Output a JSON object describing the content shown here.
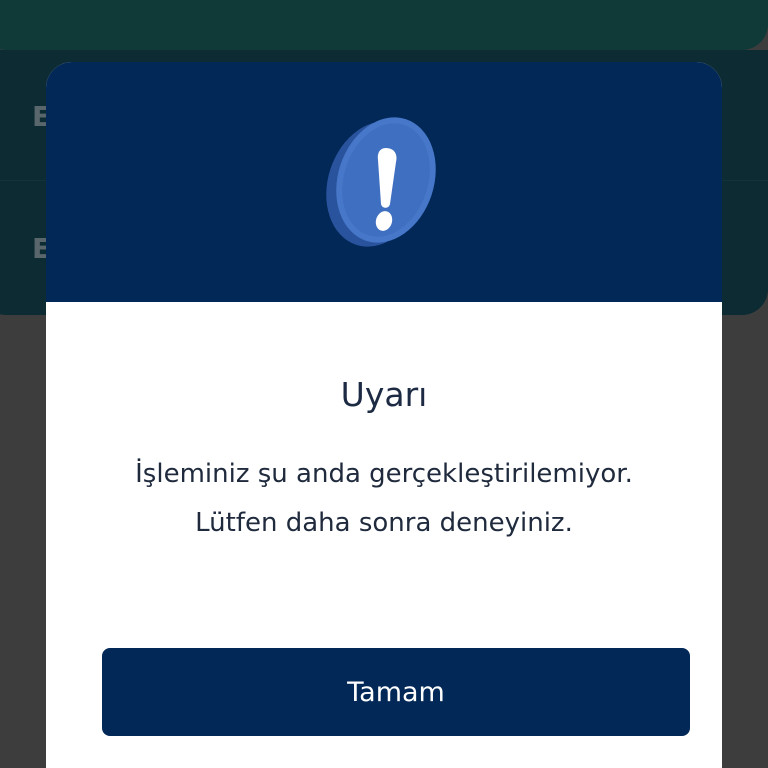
{
  "background": {
    "row_1_label": "E",
    "row_2_label": "E"
  },
  "dialog": {
    "icon": "exclamation-alert-icon",
    "title": "Uyarı",
    "message": "İşleminiz şu anda gerçekleştirilemiyor. Lütfen daha sonra deneyiniz.",
    "button_label": "Tamam"
  },
  "colors": {
    "header_navy": "#012857",
    "button_navy": "#012857",
    "icon_blue": "#3f6fc0",
    "overlay": "#3d3d3d",
    "title_text": "#1c2a43"
  }
}
